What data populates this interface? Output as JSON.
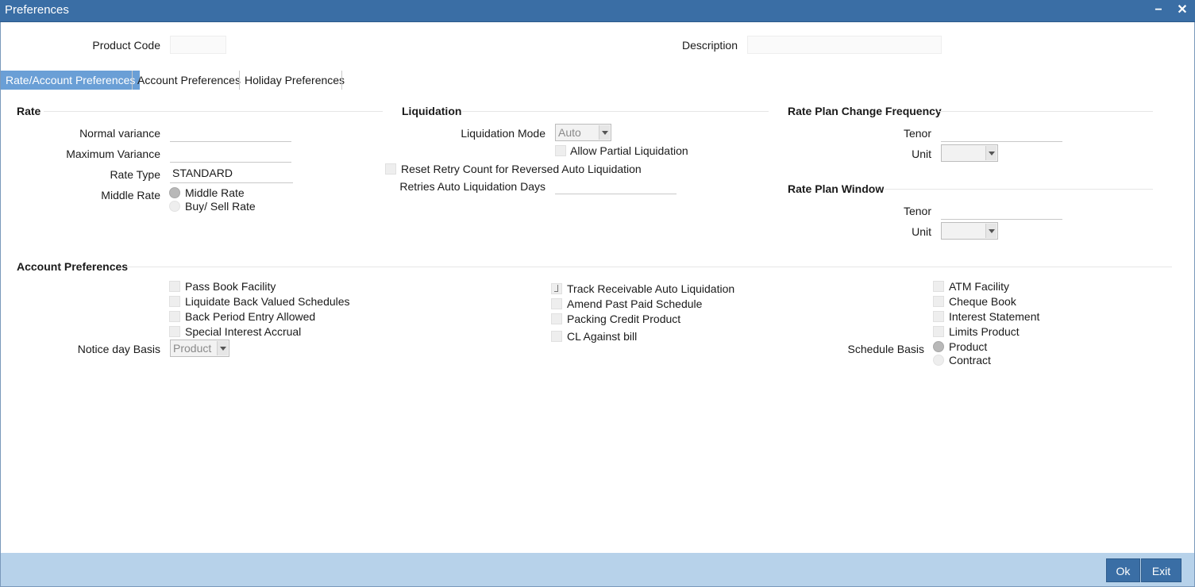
{
  "window": {
    "title": "Preferences",
    "minimize_icon": "minimize-icon",
    "close_icon": "close-icon"
  },
  "header": {
    "product_code_label": "Product Code",
    "product_code_value": "",
    "description_label": "Description",
    "description_value": ""
  },
  "tabs": [
    {
      "label": "Rate/Account Preferences",
      "active": true
    },
    {
      "label": "Account Preferences",
      "active": false
    },
    {
      "label": "Holiday Preferences",
      "active": false
    }
  ],
  "rate": {
    "title": "Rate",
    "normal_variance_label": "Normal variance",
    "normal_variance_value": "",
    "maximum_variance_label": "Maximum Variance",
    "maximum_variance_value": "",
    "rate_type_label": "Rate Type",
    "rate_type_value": "STANDARD",
    "middle_rate_label": "Middle Rate",
    "middle_rate_options": [
      {
        "label": "Middle Rate",
        "selected": true
      },
      {
        "label": "Buy/ Sell Rate",
        "selected": false
      }
    ]
  },
  "liquidation": {
    "title": "Liquidation",
    "mode_label": "Liquidation Mode",
    "mode_value": "Auto",
    "allow_partial_label": "Allow Partial Liquidation",
    "allow_partial_checked": false,
    "reset_retry_label": "Reset Retry Count for Reversed Auto Liquidation",
    "reset_retry_checked": false,
    "retries_days_label": "Retries Auto Liquidation Days",
    "retries_days_value": ""
  },
  "rate_plan_change": {
    "title": "Rate Plan Change Frequency",
    "tenor_label": "Tenor",
    "tenor_value": "",
    "unit_label": "Unit",
    "unit_value": ""
  },
  "rate_plan_window": {
    "title": "Rate Plan Window",
    "tenor_label": "Tenor",
    "tenor_value": "",
    "unit_label": "Unit",
    "unit_value": ""
  },
  "account_preferences": {
    "title": "Account Preferences",
    "col1": [
      {
        "label": "Pass Book Facility",
        "checked": false
      },
      {
        "label": "Liquidate Back Valued Schedules",
        "checked": false
      },
      {
        "label": "Back Period Entry Allowed",
        "checked": false
      },
      {
        "label": "Special Interest Accrual",
        "checked": false
      }
    ],
    "notice_day_basis_label": "Notice day Basis",
    "notice_day_basis_value": "Product",
    "col2": [
      {
        "label": "Track Receivable Auto Liquidation",
        "checked": true
      },
      {
        "label": "Amend Past Paid Schedule",
        "checked": false
      },
      {
        "label": "Packing Credit Product",
        "checked": false
      },
      {
        "label": "CL Against bill",
        "checked": false
      }
    ],
    "col3": [
      {
        "label": "ATM Facility",
        "checked": false
      },
      {
        "label": "Cheque Book",
        "checked": false
      },
      {
        "label": "Interest Statement",
        "checked": false
      },
      {
        "label": "Limits Product",
        "checked": false
      }
    ],
    "schedule_basis_label": "Schedule Basis",
    "schedule_basis_options": [
      {
        "label": "Product",
        "selected": true
      },
      {
        "label": "Contract",
        "selected": false
      }
    ]
  },
  "footer": {
    "ok_label": "Ok",
    "exit_label": "Exit"
  }
}
